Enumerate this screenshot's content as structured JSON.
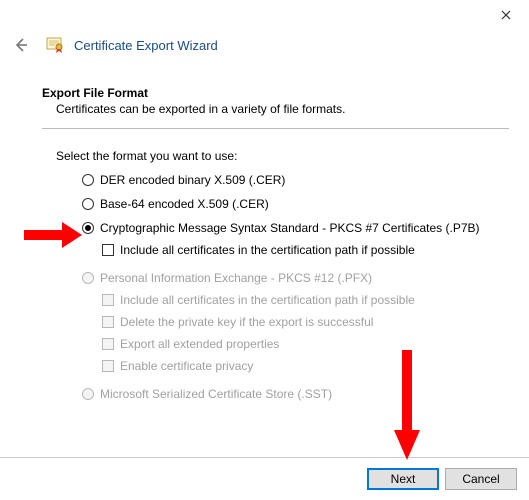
{
  "window": {
    "title": "Certificate Export Wizard"
  },
  "section": {
    "title": "Export File Format",
    "subtitle": "Certificates can be exported in a variety of file formats."
  },
  "prompt": "Select the format you want to use:",
  "options": {
    "der": "DER encoded binary X.509 (.CER)",
    "b64": "Base-64 encoded X.509 (.CER)",
    "p7b": "Cryptographic Message Syntax Standard - PKCS #7 Certificates (.P7B)",
    "p7b_include": "Include all certificates in the certification path if possible",
    "pfx": "Personal Information Exchange - PKCS #12 (.PFX)",
    "pfx_include": "Include all certificates in the certification path if possible",
    "pfx_delete": "Delete the private key if the export is successful",
    "pfx_ext": "Export all extended properties",
    "pfx_priv": "Enable certificate privacy",
    "sst": "Microsoft Serialized Certificate Store (.SST)"
  },
  "buttons": {
    "next": "Next",
    "cancel": "Cancel"
  },
  "state": {
    "selected": "p7b"
  },
  "colors": {
    "accent": "#0078d7",
    "title": "#1a4a8a",
    "arrow": "#ff0000"
  }
}
